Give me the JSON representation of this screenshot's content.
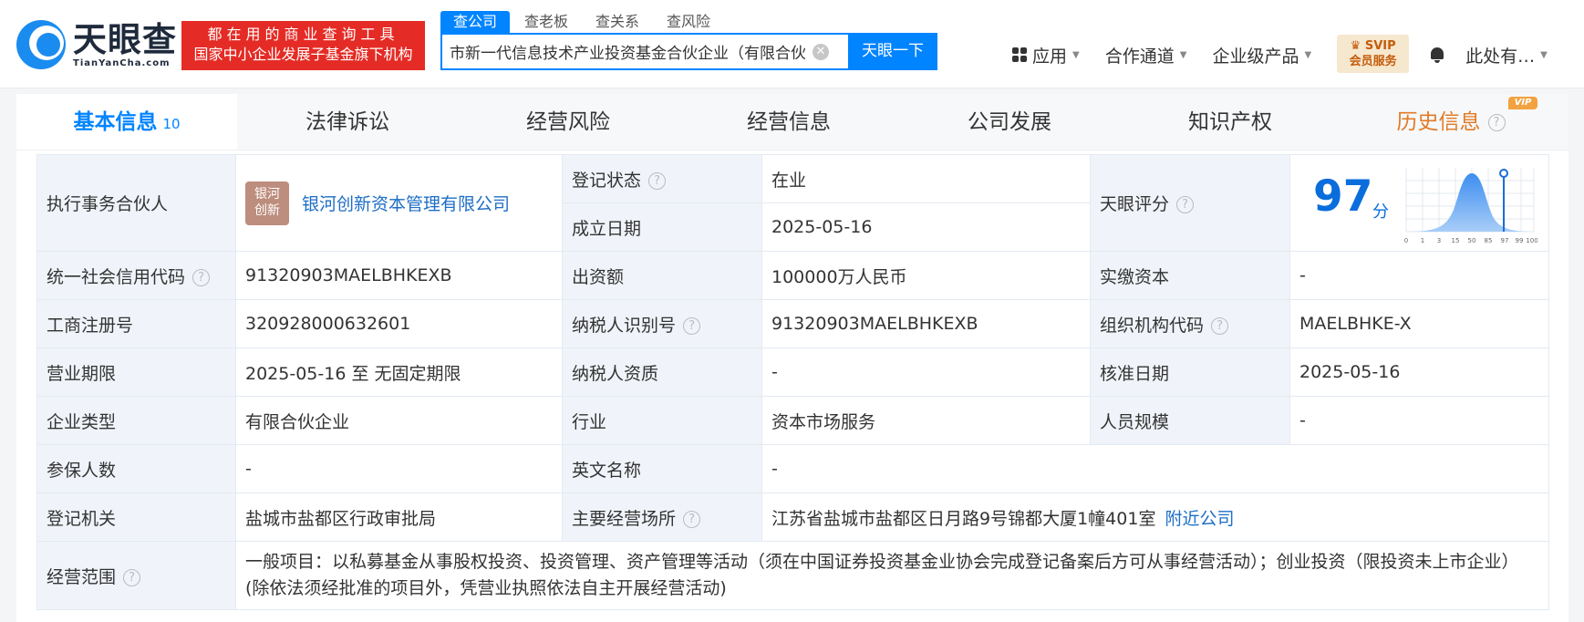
{
  "header": {
    "logo_name": "天眼查",
    "logo_domain": "TianYanCha.com",
    "slogan_line1": "都在用的商业查询工具",
    "slogan_line2": "国家中小企业发展子基金旗下机构",
    "search_tabs": [
      "查公司",
      "查老板",
      "查关系",
      "查风险"
    ],
    "search_value": "市新一代信息技术产业投资基金合伙企业（有限合伙）",
    "clear_symbol": "✕",
    "search_button": "天眼一下",
    "nav": [
      "应用",
      "合作通道",
      "企业级产品"
    ],
    "svip_line1": "SVIP",
    "svip_line2": "会员服务",
    "user": "此处有…"
  },
  "tabs": [
    {
      "label": "基本信息",
      "count": "10"
    },
    {
      "label": "法律诉讼"
    },
    {
      "label": "经营风险"
    },
    {
      "label": "经营信息"
    },
    {
      "label": "公司发展"
    },
    {
      "label": "知识产权"
    },
    {
      "label": "历史信息",
      "tag": "VIP"
    }
  ],
  "info": {
    "partner_label": "执行事务合伙人",
    "partner_logo_line1": "银河",
    "partner_logo_line2": "创新",
    "partner_name": "银河创新资本管理有限公司",
    "status_label": "登记状态",
    "status_value": "在业",
    "founded_label": "成立日期",
    "founded_value": "2025-05-16",
    "score_label": "天眼评分",
    "score_value": "97",
    "score_unit": "分",
    "score_axis": [
      "0",
      "1",
      "3",
      "15",
      "50",
      "85",
      "97",
      "99",
      "100"
    ],
    "credit_label": "统一社会信用代码",
    "credit_value": "91320903MAELBHKEXB",
    "capital_label": "出资额",
    "capital_value": "100000万人民币",
    "paid_label": "实缴资本",
    "paid_value": "-",
    "reg_label": "工商注册号",
    "reg_value": "320928000632601",
    "tax_label": "纳税人识别号",
    "tax_value": "91320903MAELBHKEXB",
    "org_label": "组织机构代码",
    "org_value": "MAELBHKE-X",
    "term_label": "营业期限",
    "term_value": "2025-05-16 至 无固定期限",
    "taxq_label": "纳税人资质",
    "taxq_value": "-",
    "approve_label": "核准日期",
    "approve_value": "2025-05-16",
    "type_label": "企业类型",
    "type_value": "有限合伙企业",
    "industry_label": "行业",
    "industry_value": "资本市场服务",
    "staff_label": "人员规模",
    "staff_value": "-",
    "insured_label": "参保人数",
    "insured_value": "-",
    "english_label": "英文名称",
    "english_value": "-",
    "authority_label": "登记机关",
    "authority_value": "盐城市盐都区行政审批局",
    "address_label": "主要经营场所",
    "address_value": "江苏省盐城市盐都区日月路9号锦都大厦1幢401室",
    "nearby_link": "附近公司",
    "scope_label": "经营范围",
    "scope_value": "一般项目：以私募基金从事股权投资、投资管理、资产管理等活动（须在中国证券投资基金业协会完成登记备案后方可从事经营活动）；创业投资（限投资未上市企业）(除依法须经批准的项目外，凭营业执照依法自主开展经营活动)"
  },
  "colors": {
    "accent": "#0084ff",
    "slogan_bg": "#e52b25",
    "status_green": "#16a34a",
    "score_blue": "#0a6ddc",
    "history_orange": "#e07b26"
  },
  "icons": [
    "clear-icon",
    "apps-icon",
    "chevron-down-icon",
    "bell-icon",
    "help-icon",
    "crown-icon"
  ]
}
